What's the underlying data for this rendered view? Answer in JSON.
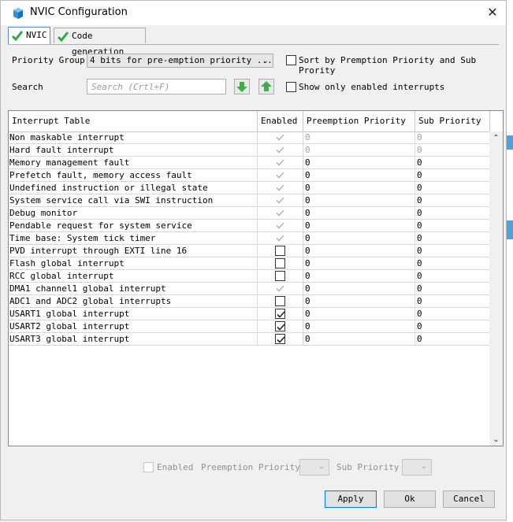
{
  "window": {
    "title": "NVIC Configuration",
    "close_glyph": "✕"
  },
  "tabs": [
    {
      "label": "NVIC",
      "active": true
    },
    {
      "label": "Code generation",
      "active": false
    }
  ],
  "form": {
    "priority_group_label": "Priority Group",
    "priority_group_value": "4 bits for pre-emption priority ...",
    "sort_label": "Sort by Premption Priority and Sub Prority",
    "search_label": "Search",
    "search_placeholder": "Search (Crtl+F)",
    "show_enabled_label": "Show only enabled interrupts"
  },
  "table": {
    "headers": [
      "Interrupt Table",
      "Enabled",
      "Preemption Priority",
      "Sub Priority"
    ],
    "rows": [
      {
        "name": "Non maskable interrupt",
        "enabled": true,
        "locked": true,
        "pre": "0",
        "sub": "0"
      },
      {
        "name": "Hard fault interrupt",
        "enabled": true,
        "locked": true,
        "pre": "0",
        "sub": "0"
      },
      {
        "name": "Memory management fault",
        "enabled": true,
        "locked": true,
        "pre": "0",
        "sub": "0"
      },
      {
        "name": "Prefetch fault, memory access fault",
        "enabled": true,
        "locked": true,
        "pre": "0",
        "sub": "0"
      },
      {
        "name": "Undefined instruction or illegal state",
        "enabled": true,
        "locked": true,
        "pre": "0",
        "sub": "0"
      },
      {
        "name": "System service call via SWI instruction",
        "enabled": true,
        "locked": true,
        "pre": "0",
        "sub": "0"
      },
      {
        "name": "Debug monitor",
        "enabled": true,
        "locked": true,
        "pre": "0",
        "sub": "0"
      },
      {
        "name": "Pendable request for system service",
        "enabled": true,
        "locked": true,
        "pre": "0",
        "sub": "0"
      },
      {
        "name": "Time base: System tick timer",
        "enabled": true,
        "locked": true,
        "pre": "0",
        "sub": "0"
      },
      {
        "name": "PVD interrupt through EXTI line 16",
        "enabled": false,
        "locked": false,
        "pre": "0",
        "sub": "0"
      },
      {
        "name": "Flash global interrupt",
        "enabled": false,
        "locked": false,
        "pre": "0",
        "sub": "0"
      },
      {
        "name": "RCC global interrupt",
        "enabled": false,
        "locked": false,
        "pre": "0",
        "sub": "0"
      },
      {
        "name": "DMA1 channel1 global interrupt",
        "enabled": true,
        "locked": true,
        "pre": "0",
        "sub": "0"
      },
      {
        "name": "ADC1 and ADC2 global interrupts",
        "enabled": false,
        "locked": false,
        "pre": "0",
        "sub": "0"
      },
      {
        "name": "USART1 global interrupt",
        "enabled": true,
        "locked": false,
        "pre": "0",
        "sub": "0"
      },
      {
        "name": "USART2 global interrupt",
        "enabled": true,
        "locked": false,
        "pre": "0",
        "sub": "0"
      },
      {
        "name": "USART3 global interrupt",
        "enabled": true,
        "locked": false,
        "pre": "0",
        "sub": "0"
      }
    ]
  },
  "detail": {
    "enabled_label": "Enabled",
    "preemption_label": "Preemption Priority",
    "sub_label": "Sub Priority"
  },
  "buttons": {
    "apply": "Apply",
    "ok": "Ok",
    "cancel": "Cancel"
  },
  "icons": {
    "app": "cube-icon",
    "tab_check": "green-check-icon",
    "move_down": "green-down-arrow-icon",
    "move_up": "green-up-arrow-icon"
  },
  "colors": {
    "check_green": "#2ea84a",
    "accent_blue": "#0078d7",
    "disabled_text": "#a0a0a0"
  }
}
